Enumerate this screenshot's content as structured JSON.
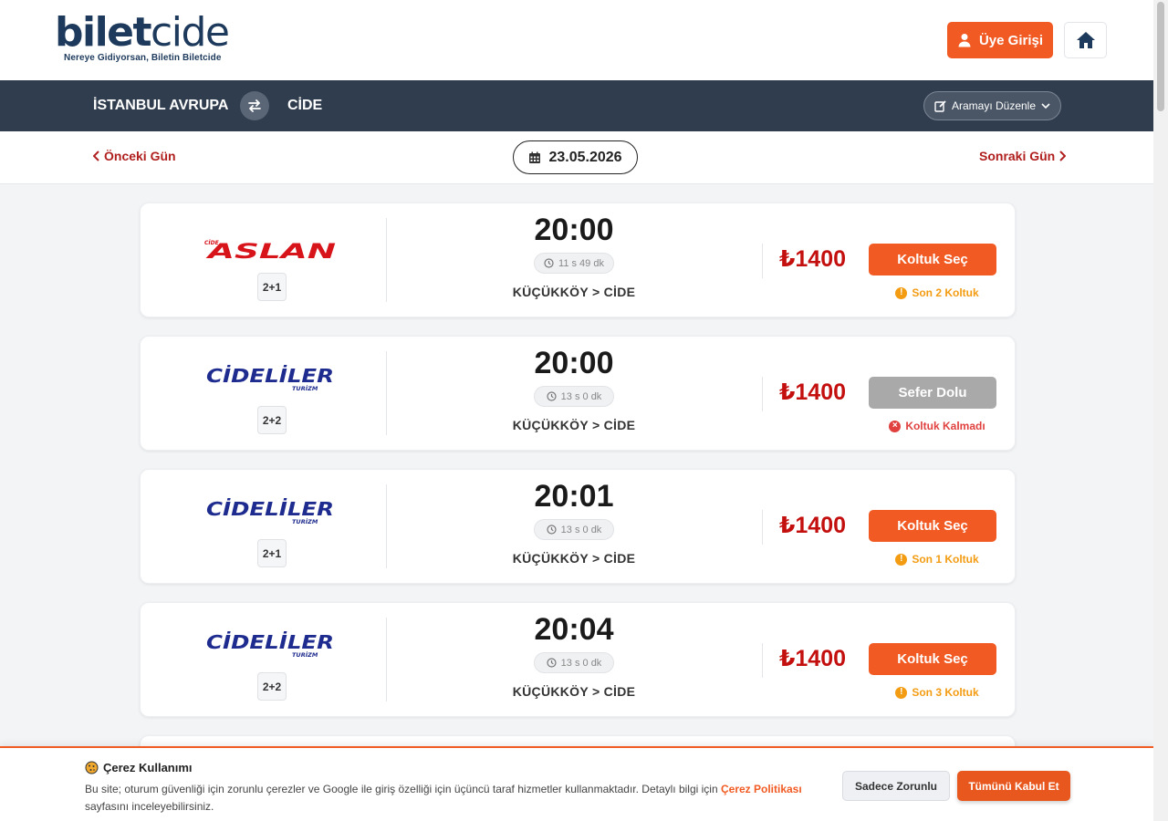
{
  "header": {
    "logo_bold": "bilet",
    "logo_thin": "cide",
    "logo_tagline": "Nereye Gidiyorsan, Biletin Biletcide",
    "login_label": "Üye Girişi",
    "home_icon": "home-icon",
    "user_icon": "user-icon"
  },
  "route": {
    "from": "İSTANBUL AVRUPA",
    "to": "CİDE",
    "edit_label": "Aramayı Düzenle"
  },
  "date_nav": {
    "prev_label": "Önceki Gün",
    "next_label": "Sonraki Gün",
    "date": "23.05.2026"
  },
  "trips": [
    {
      "company": "ASLAN",
      "company_prefix": "CİDE",
      "layout": "2+1",
      "time": "20:00",
      "duration": "11 s 49 dk",
      "route": "KÜÇÜKKÖY > CİDE",
      "price": "₺1400",
      "button": "Koltuk Seç",
      "status": "available",
      "note": "Son 2 Koltuk"
    },
    {
      "company": "CİDELİLER",
      "company_sub": "TURİZM",
      "layout": "2+2",
      "time": "20:00",
      "duration": "13 s 0 dk",
      "route": "KÜÇÜKKÖY > CİDE",
      "price": "₺1400",
      "button": "Sefer Dolu",
      "status": "full",
      "note": "Koltuk Kalmadı"
    },
    {
      "company": "CİDELİLER",
      "company_sub": "TURİZM",
      "layout": "2+1",
      "time": "20:01",
      "duration": "13 s 0 dk",
      "route": "KÜÇÜKKÖY > CİDE",
      "price": "₺1400",
      "button": "Koltuk Seç",
      "status": "available",
      "note": "Son 1 Koltuk"
    },
    {
      "company": "CİDELİLER",
      "company_sub": "TURİZM",
      "layout": "2+2",
      "time": "20:04",
      "duration": "13 s 0 dk",
      "route": "KÜÇÜKKÖY > CİDE",
      "price": "₺1400",
      "button": "Koltuk Seç",
      "status": "available",
      "note": "Son 3 Koltuk"
    }
  ],
  "cookie": {
    "title": "Çerez Kullanımı",
    "text_before": "Bu site; oturum güvenliği için zorunlu çerezler ve Google ile giriş özelliği için üçüncü taraf hizmetler kullanmaktadır. Detaylı bilgi için ",
    "link_label": "Çerez Politikası",
    "text_after": " sayfasını inceleyebilirsiniz.",
    "required_label": "Sadece Zorunlu",
    "accept_label": "Tümünü Kabul Et"
  },
  "colors": {
    "accent": "#f15a22",
    "navy": "#1d3a5c",
    "route_bar": "#2f3d4e",
    "price_red": "#c40f0f",
    "warning": "#f39c12",
    "danger": "#e0413f"
  }
}
